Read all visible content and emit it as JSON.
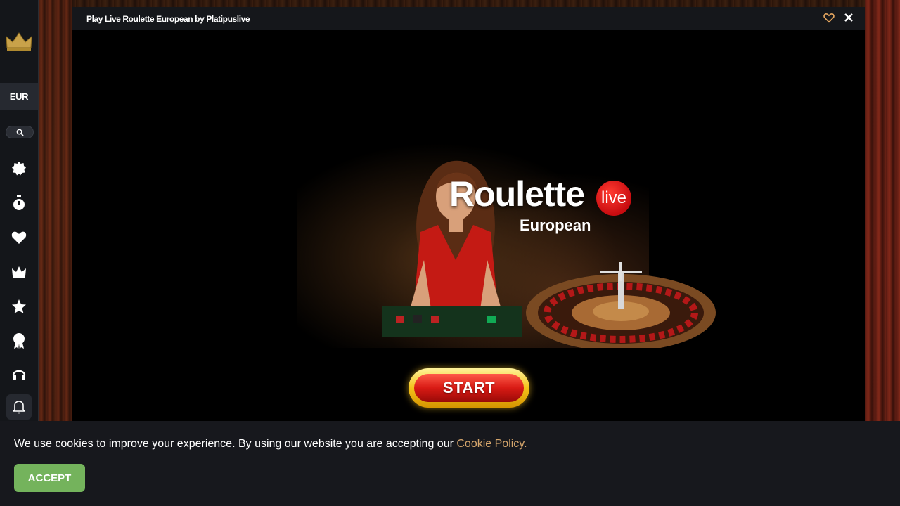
{
  "sidebar": {
    "currency": "EUR",
    "icons": [
      "crown-logo-icon",
      "search-icon",
      "new-badge-icon",
      "stopwatch-icon",
      "heart-icon",
      "crown-icon",
      "star-icon",
      "award-icon",
      "headset-icon",
      "bell-icon"
    ]
  },
  "modal": {
    "title": "Play Live Roulette European by Platipuslive",
    "game": {
      "title_main": "Roulette",
      "title_badge": "live",
      "title_sub": "European",
      "start_label": "START"
    }
  },
  "cookie": {
    "text": "We use cookies to improve your experience. By using our website you are accepting our ",
    "link": "Cookie Policy.",
    "accept_label": "ACCEPT"
  },
  "colors": {
    "accent_gold": "#d6a66c",
    "accept_green": "#74b35c",
    "live_red": "#c80c10"
  }
}
